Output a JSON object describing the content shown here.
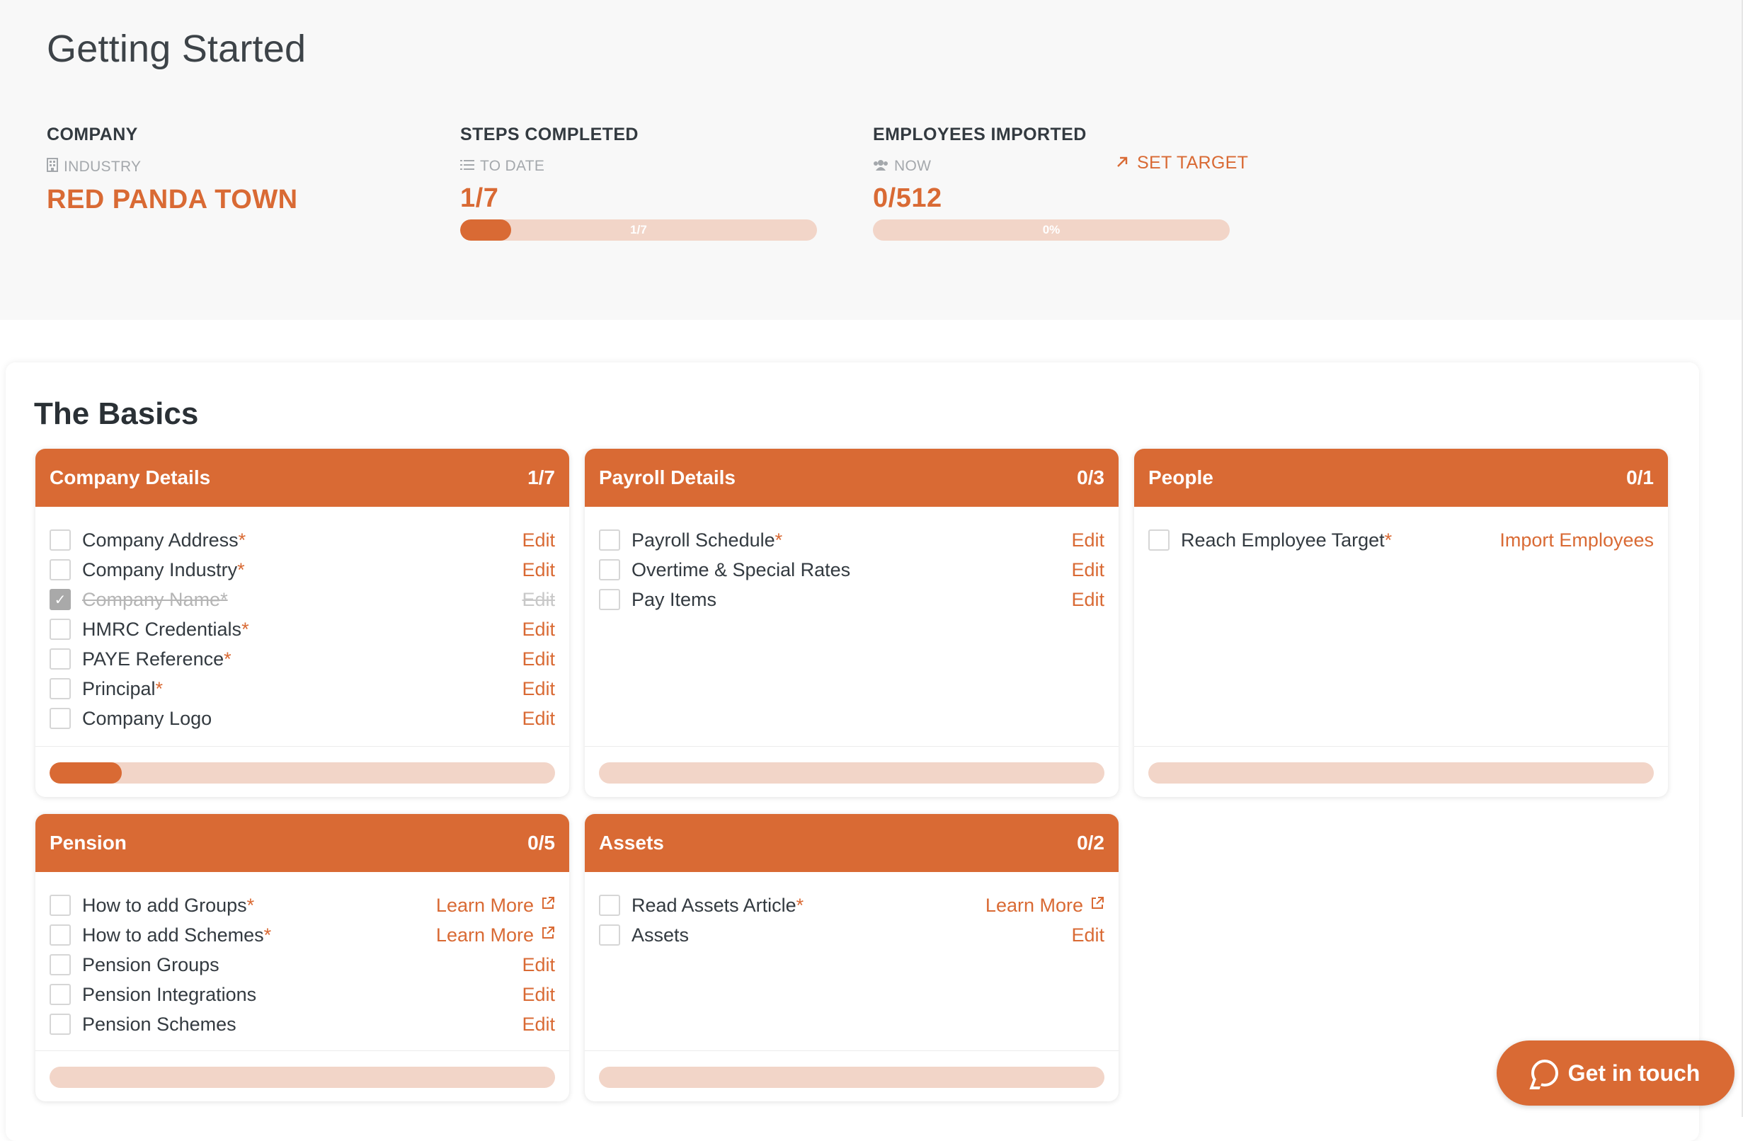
{
  "page": {
    "title": "Getting Started"
  },
  "stats": {
    "company": {
      "label": "COMPANY",
      "sub": "INDUSTRY",
      "sub_icon": "building-icon",
      "value": "RED PANDA TOWN"
    },
    "steps": {
      "label": "STEPS COMPLETED",
      "sub": "TO DATE",
      "sub_icon": "list-icon",
      "value": "1/7",
      "bar_text": "1/7",
      "progress": 0.14
    },
    "employees": {
      "label": "EMPLOYEES IMPORTED",
      "sub": "NOW",
      "sub_icon": "people-icon",
      "value": "0/512",
      "bar_text": "0%",
      "progress": 0.0,
      "set_target": "SET TARGET",
      "set_target_icon": "arrow-up-right-icon"
    }
  },
  "basics": {
    "title": "The Basics",
    "panels": {
      "company_details": {
        "title": "Company Details",
        "count": "1/7",
        "progress": 0.1429,
        "items": [
          {
            "label": "Company Address",
            "required": "*",
            "action": "Edit",
            "checked": false
          },
          {
            "label": "Company Industry",
            "required": "*",
            "action": "Edit",
            "checked": false
          },
          {
            "label": "Company Name",
            "required": "*",
            "action": "Edit",
            "checked": true
          },
          {
            "label": "HMRC Credentials",
            "required": "*",
            "action": "Edit",
            "checked": false
          },
          {
            "label": "PAYE Reference",
            "required": "*",
            "action": "Edit",
            "checked": false
          },
          {
            "label": "Principal",
            "required": "*",
            "action": "Edit",
            "checked": false
          },
          {
            "label": "Company Logo",
            "required": "",
            "action": "Edit",
            "checked": false
          }
        ]
      },
      "payroll_details": {
        "title": "Payroll Details",
        "count": "0/3",
        "progress": 0,
        "items": [
          {
            "label": "Payroll Schedule",
            "required": "*",
            "action": "Edit",
            "checked": false
          },
          {
            "label": "Overtime & Special Rates",
            "required": "",
            "action": "Edit",
            "checked": false
          },
          {
            "label": "Pay Items",
            "required": "",
            "action": "Edit",
            "checked": false
          }
        ]
      },
      "people": {
        "title": "People",
        "count": "0/1",
        "progress": 0,
        "items": [
          {
            "label": "Reach Employee Target",
            "required": "*",
            "action": "Import Employees",
            "checked": false
          }
        ]
      },
      "pension": {
        "title": "Pension",
        "count": "0/5",
        "progress": 0,
        "items": [
          {
            "label": "How to add Groups",
            "required": "*",
            "action": "Learn More",
            "external": true,
            "checked": false
          },
          {
            "label": "How to add Schemes",
            "required": "*",
            "action": "Learn More",
            "external": true,
            "checked": false
          },
          {
            "label": "Pension Groups",
            "required": "",
            "action": "Edit",
            "checked": false
          },
          {
            "label": "Pension Integrations",
            "required": "",
            "action": "Edit",
            "checked": false
          },
          {
            "label": "Pension Schemes",
            "required": "",
            "action": "Edit",
            "checked": false
          }
        ]
      },
      "assets": {
        "title": "Assets",
        "count": "0/2",
        "progress": 0,
        "items": [
          {
            "label": "Read Assets Article",
            "required": "*",
            "action": "Learn More",
            "external": true,
            "checked": false
          },
          {
            "label": "Assets",
            "required": "",
            "action": "Edit",
            "checked": false
          }
        ]
      }
    }
  },
  "chat": {
    "label": "Get in touch",
    "icon": "chat-bubble-icon"
  },
  "colors": {
    "accent": "#d96a34",
    "accent_light": "#f2d5c8",
    "header_bg": "#f8f8f8"
  }
}
